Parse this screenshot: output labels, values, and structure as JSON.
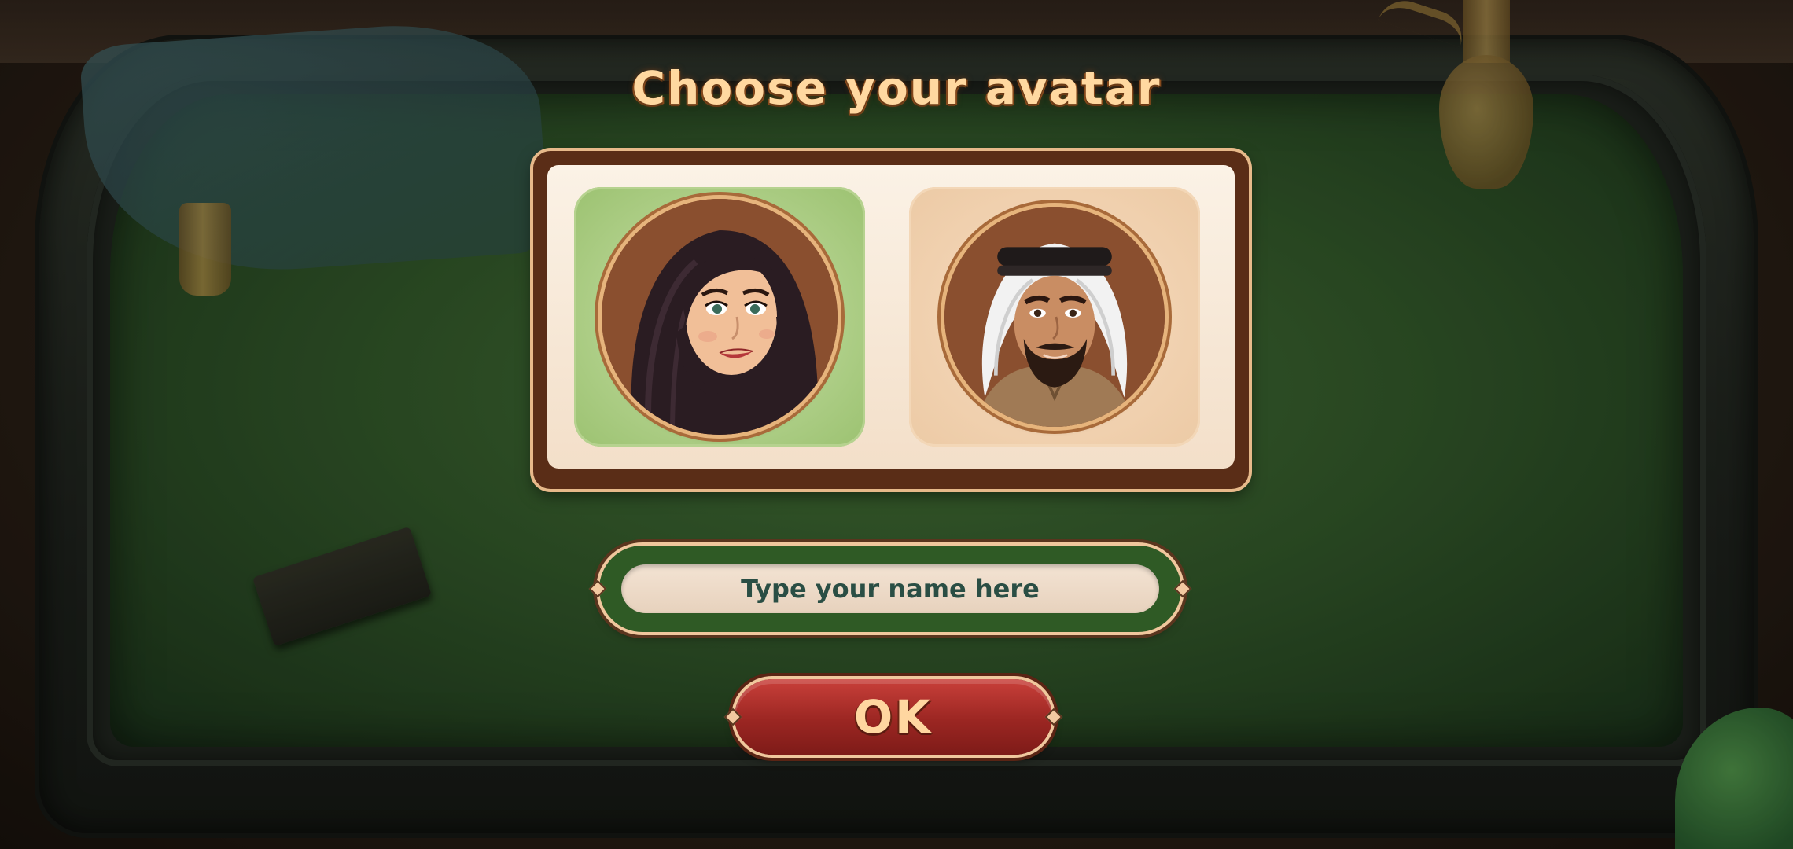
{
  "dialog": {
    "title": "Choose your avatar"
  },
  "avatars": [
    {
      "name": "woman-in-hijab",
      "selected": true
    },
    {
      "name": "man-in-ghutra",
      "selected": false
    }
  ],
  "name_input": {
    "placeholder": "Type your name here",
    "value": ""
  },
  "ok_button": {
    "label": "OK"
  },
  "colors": {
    "felt": "#2f5428",
    "title_text": "#ffd8a0",
    "selected_card": "#9cc271",
    "ok_button": "#9b2622"
  }
}
